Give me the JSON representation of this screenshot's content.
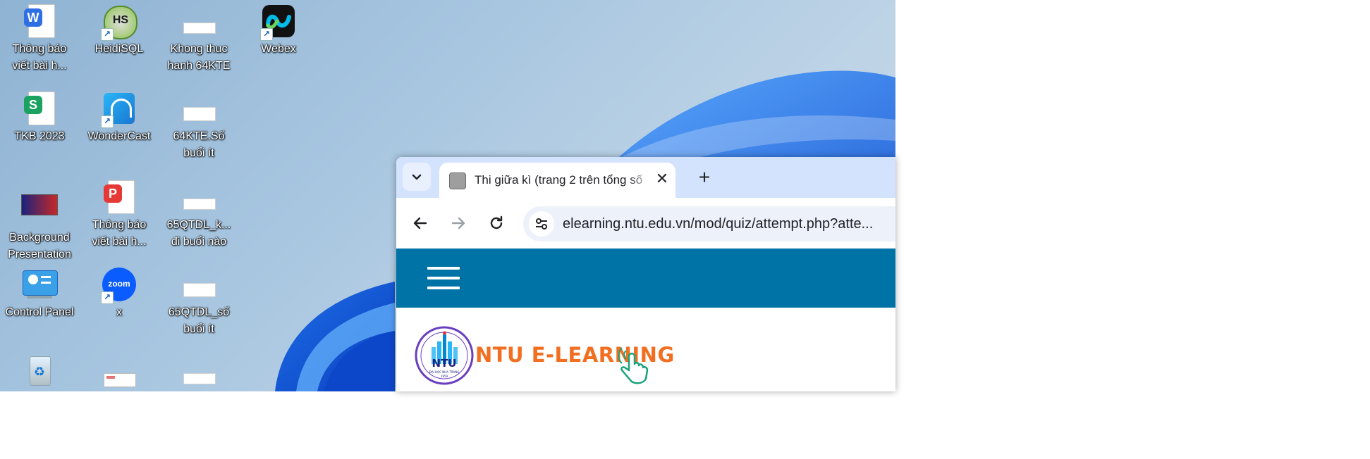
{
  "desktop": {
    "icons": [
      {
        "label": "Thông báo\nviết bài h...",
        "icon": "wps-writer-doc-icon"
      },
      {
        "label": "HeidiSQL",
        "icon": "heidisql-icon"
      },
      {
        "label": "Khong thuc\nhanh 64KTE",
        "icon": "sheet-thumbnail-icon"
      },
      {
        "label": "Webex",
        "icon": "webex-icon"
      },
      {
        "label": "TKB 2023",
        "icon": "wps-spreadsheet-icon"
      },
      {
        "label": "WonderCast",
        "icon": "wondercast-icon"
      },
      {
        "label": "64KTE.Số\nbuổi ít",
        "icon": "sheet-thumbnail-icon"
      },
      {
        "label": "Background\nPresentation",
        "icon": "presentation-thumbnail-icon"
      },
      {
        "label": "Thông báo\nviết bài h...",
        "icon": "wps-pdf-icon"
      },
      {
        "label": "65QTDL_k...\nđi buổi nào",
        "icon": "sheet-thumbnail-icon"
      },
      {
        "label": "Control Panel",
        "icon": "control-panel-icon"
      },
      {
        "label": "x",
        "icon": "zoom-icon"
      },
      {
        "label": "65QTDL_số\nbuổi ít",
        "icon": "sheet-thumbnail-icon"
      },
      {
        "label": "",
        "icon": "recycle-bin-icon"
      },
      {
        "label": "",
        "icon": "document-thumbnail-icon"
      },
      {
        "label": "",
        "icon": "sheet-thumbnail-icon"
      }
    ]
  },
  "browser": {
    "tab_title": "Thi giữa kì (trang 2 trên tổng số",
    "url": "elearning.ntu.edu.vn/mod/quiz/attempt.php?atte...",
    "icons": {
      "tab_search": "chevron-down-icon",
      "close": "close-icon",
      "new_tab": "plus-icon",
      "back": "back-arrow-icon",
      "forward": "forward-arrow-icon",
      "reload": "reload-icon",
      "site_info": "tune-icon"
    }
  },
  "site": {
    "logo_text": "NTU E-LEARNING",
    "seal_text": "NTU",
    "seal_caption": "ĐẠI HỌC NHA TRANG",
    "seal_year": "1959"
  },
  "colors": {
    "header_blue": "#0073a6",
    "logo_orange": "#f26f21",
    "tabstrip": "#d3e3fd",
    "omnibox": "#edf2fa"
  }
}
